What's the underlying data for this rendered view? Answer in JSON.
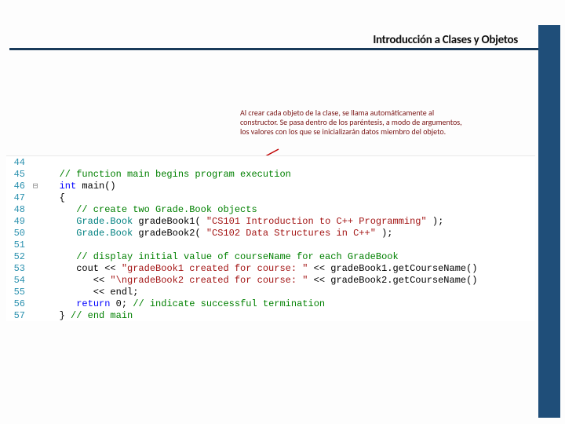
{
  "header": {
    "title": "Introducción a Clases y Objetos"
  },
  "annotation": {
    "text": "Al crear cada objeto de la clase, se llama automáticamente al constructor. Se pasa dentro de los paréntesis, a modo de argumentos, los valores con los que se inicializarán datos miembro del objeto."
  },
  "code": {
    "lines": [
      {
        "n": "44",
        "fold": "",
        "segs": [
          {
            "t": "   ",
            "c": ""
          }
        ]
      },
      {
        "n": "45",
        "fold": "",
        "segs": [
          {
            "t": "   // function main begins program execution",
            "c": "c-comment"
          }
        ]
      },
      {
        "n": "46",
        "fold": "⊟",
        "segs": [
          {
            "t": "   ",
            "c": ""
          },
          {
            "t": "int",
            "c": "c-keyword"
          },
          {
            "t": " main()",
            "c": ""
          }
        ]
      },
      {
        "n": "47",
        "fold": "",
        "segs": [
          {
            "t": "   {",
            "c": ""
          }
        ]
      },
      {
        "n": "48",
        "fold": "",
        "segs": [
          {
            "t": "      // create two Grade.Book objects",
            "c": "c-comment"
          }
        ]
      },
      {
        "n": "49",
        "fold": "",
        "segs": [
          {
            "t": "      ",
            "c": ""
          },
          {
            "t": "Grade.Book",
            "c": "c-type"
          },
          {
            "t": " gradeBook1( ",
            "c": ""
          },
          {
            "t": "\"CS101 Introduction to C++ Programming\"",
            "c": "c-string"
          },
          {
            "t": " );",
            "c": ""
          }
        ]
      },
      {
        "n": "50",
        "fold": "",
        "segs": [
          {
            "t": "      ",
            "c": ""
          },
          {
            "t": "Grade.Book",
            "c": "c-type"
          },
          {
            "t": " gradeBook2( ",
            "c": ""
          },
          {
            "t": "\"CS102 Data Structures in C++\"",
            "c": "c-string"
          },
          {
            "t": " );",
            "c": ""
          }
        ]
      },
      {
        "n": "51",
        "fold": "",
        "segs": [
          {
            "t": "   ",
            "c": ""
          }
        ]
      },
      {
        "n": "52",
        "fold": "",
        "segs": [
          {
            "t": "      // display initial value of courseName for each GradeBook",
            "c": "c-comment"
          }
        ]
      },
      {
        "n": "53",
        "fold": "",
        "segs": [
          {
            "t": "      cout << ",
            "c": ""
          },
          {
            "t": "\"gradeBook1 created for course: \"",
            "c": "c-string"
          },
          {
            "t": " << gradeBook1.getCourseName()",
            "c": ""
          }
        ]
      },
      {
        "n": "54",
        "fold": "",
        "segs": [
          {
            "t": "         << ",
            "c": ""
          },
          {
            "t": "\"\\ngradeBook2 created for course: \"",
            "c": "c-string"
          },
          {
            "t": " << gradeBook2.getCourseName()",
            "c": ""
          }
        ]
      },
      {
        "n": "55",
        "fold": "",
        "segs": [
          {
            "t": "         << endl;",
            "c": ""
          }
        ]
      },
      {
        "n": "56",
        "fold": "",
        "segs": [
          {
            "t": "      ",
            "c": ""
          },
          {
            "t": "return",
            "c": "c-keyword"
          },
          {
            "t": " 0; ",
            "c": ""
          },
          {
            "t": "// indicate successful termination",
            "c": "c-comment"
          }
        ]
      },
      {
        "n": "57",
        "fold": "",
        "segs": [
          {
            "t": "   } ",
            "c": ""
          },
          {
            "t": "// end main",
            "c": "c-comment"
          }
        ]
      }
    ]
  }
}
